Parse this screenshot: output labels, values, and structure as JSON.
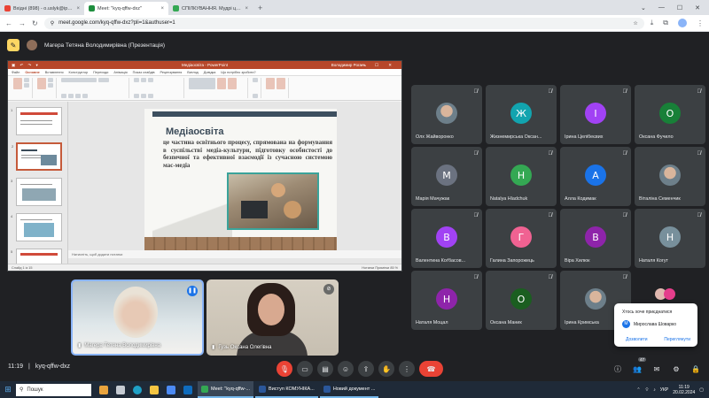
{
  "browser": {
    "tabs": [
      {
        "title": "Вхідні (898) - o.uslyk@ippo.edu...",
        "fav_color": "#ea4335",
        "active": false
      },
      {
        "title": "Meet: \"kyq-qffw-dxz\"",
        "fav_color": "#1e8e3e",
        "active": true
      },
      {
        "title": "СПІЛКУВАННЯ. Мудрі цитати...",
        "fav_color": "#34a853",
        "active": false
      }
    ],
    "url": "meet.google.com/kyq-qffw-dxz?pli=1&authuser=1"
  },
  "meet": {
    "presenter_label": "Магера Тетяна Володимирівна (Презентація)",
    "time": "11:19",
    "meeting_code": "kyq-qffw-dxz",
    "participants_count": "47",
    "accent": "#8ab4f8",
    "end_call_color": "#ea4335"
  },
  "powerpoint": {
    "window_title": "Медіаосвіта - PowerPoint",
    "user": "Володимир Рогаль",
    "tabs": [
      "Файл",
      "Основне",
      "Вставлення",
      "Конструктор",
      "Переходи",
      "Анімація",
      "Показ слайдів",
      "Рецензування",
      "Вигляд",
      "Довідка",
      "Що потрібно зробити?"
    ],
    "notes_placeholder": "Натисніть, щоб додати нотатки",
    "status_left": "Слайд 1 із 15",
    "status_right": "Нотатки   Примітки   85 %",
    "slide": {
      "title": "Медіаосвіта",
      "text": "це частина освітнього процесу, спрямована на формування в суспільстві медіа-культури, підготовку особистості до безпечної та ефективної взаємодії із сучасною системою мас-медіа"
    }
  },
  "self_videos": [
    {
      "name": "Магера Тетяна Володимирівна",
      "speaking": true
    },
    {
      "name": "Гузь Оксана Олегівна",
      "speaking": false
    }
  ],
  "participants": [
    {
      "name": "Олх Жайворонко",
      "initial": "",
      "color": "#5f6368",
      "photo": true
    },
    {
      "name": "Жизнемирська Оксан...",
      "initial": "Ж",
      "color": "#12a4af"
    },
    {
      "name": "Ірина Целібеєвих",
      "initial": "І",
      "color": "#a142f4"
    },
    {
      "name": "Оксана Фучило",
      "initial": "О",
      "color": "#188038"
    },
    {
      "name": "Марія Мачужак",
      "initial": "М",
      "color": "#6b7280"
    },
    {
      "name": "Natalya Hladchuk",
      "initial": "Н",
      "color": "#34a853"
    },
    {
      "name": "Алла Кодимак",
      "initial": "А",
      "color": "#1a73e8"
    },
    {
      "name": "Віталіна Семенчик",
      "initial": "",
      "color": "#5f6368",
      "photo": true
    },
    {
      "name": "Валентина Коґбасов...",
      "initial": "В",
      "color": "#a142f4"
    },
    {
      "name": "Галина Запорожець",
      "initial": "Г",
      "color": "#f06292"
    },
    {
      "name": "Віра Хилюк",
      "initial": "В",
      "color": "#8e24aa"
    },
    {
      "name": "Наталя Когут",
      "initial": "Н",
      "color": "#78909c"
    },
    {
      "name": "Наталя Моцал",
      "initial": "Н",
      "color": "#8e24aa"
    },
    {
      "name": "Оксана Маник",
      "initial": "О",
      "color": "#1b5e20"
    },
    {
      "name": "Ірина Кримська",
      "initial": "",
      "color": "#5f6368",
      "photo": true
    },
    {
      "name": "",
      "initial": "",
      "color": "#3c4043"
    }
  ],
  "join_popup": {
    "title": "Хтось хоче приєднатися",
    "user": "Мирослава Шоварко",
    "user_initial": "М",
    "allow": "Дозволити",
    "view": "Переглянути"
  },
  "taskbar": {
    "search_placeholder": "Пошук",
    "apps": [
      {
        "label": "Meet: \"kyq-qffw-...",
        "color": "#34a853",
        "active": true
      },
      {
        "label": "Виступ КОМУНІКА...",
        "color": "#2b579a",
        "active": false
      },
      {
        "label": "Новий документ ...",
        "color": "#2b579a",
        "active": false
      }
    ],
    "lang": "УКР",
    "time": "11:19",
    "date": "20.02.2024"
  }
}
